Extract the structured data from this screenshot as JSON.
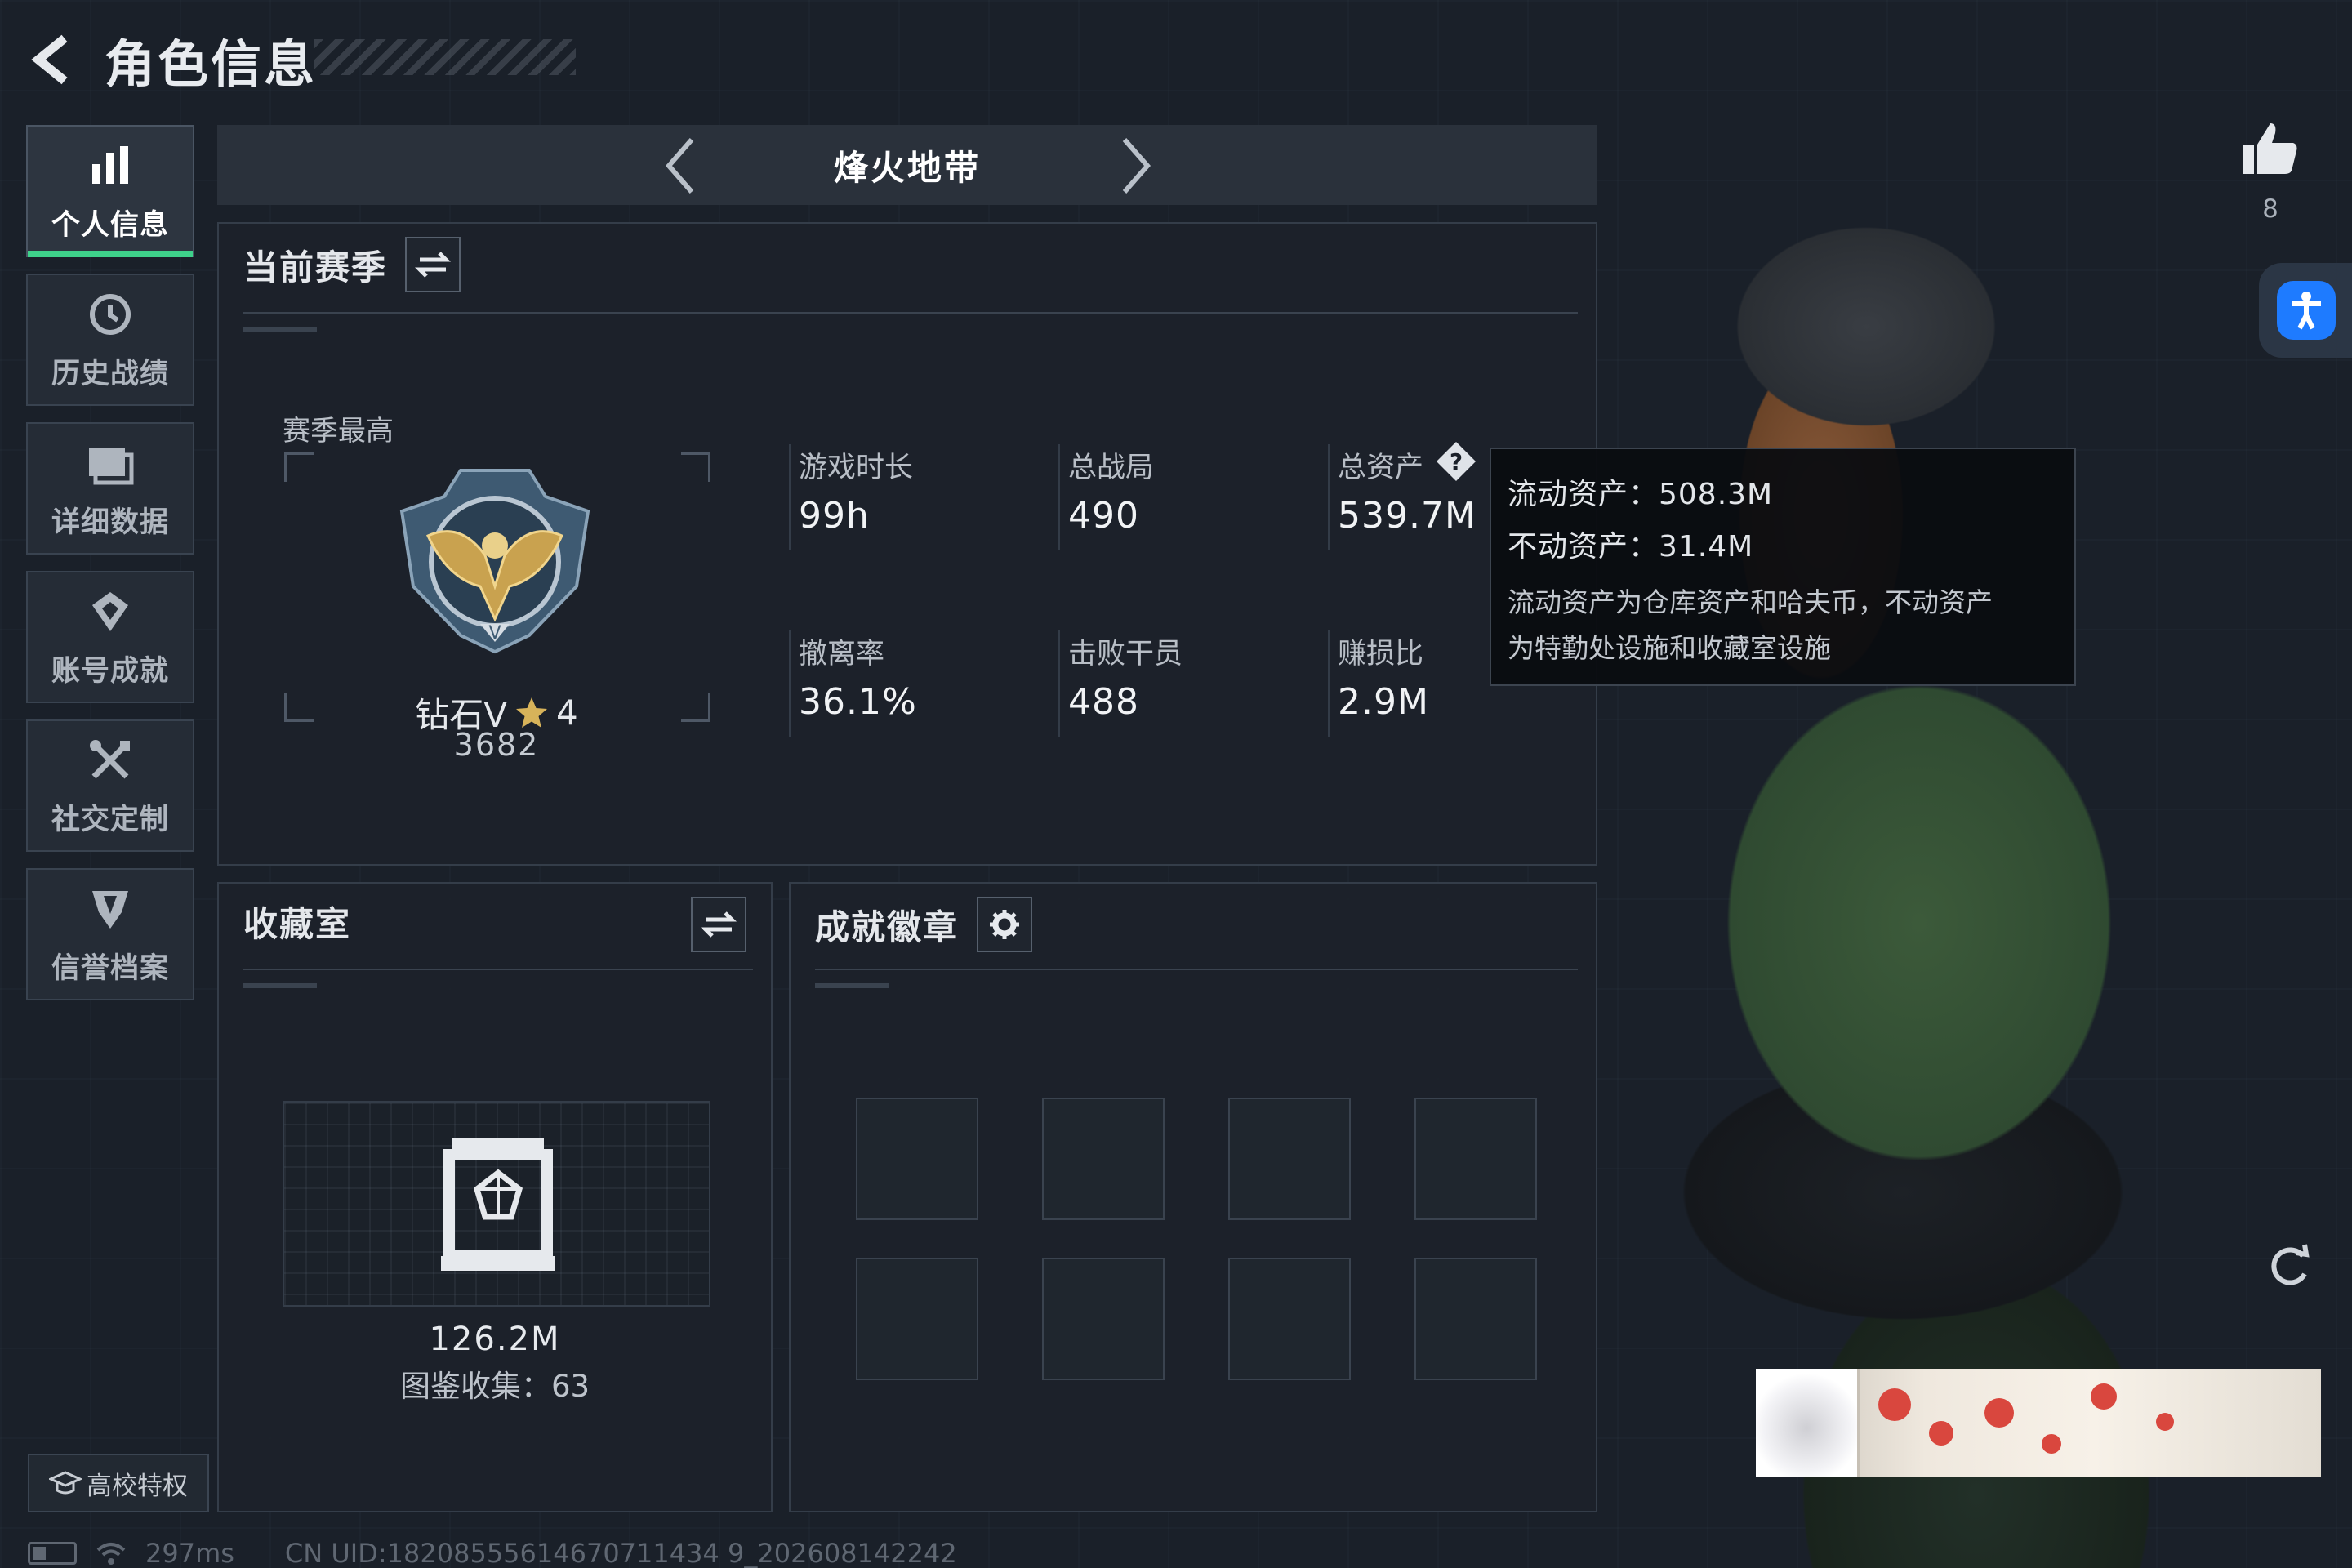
{
  "header": {
    "title": "角色信息"
  },
  "sidebar": {
    "items": [
      {
        "label": "个人信息",
        "icon": "bar-chart-icon",
        "active": true
      },
      {
        "label": "历史战绩",
        "icon": "history-clock-icon",
        "active": false
      },
      {
        "label": "详细数据",
        "icon": "folder-icon",
        "active": false
      },
      {
        "label": "账号成就",
        "icon": "achievement-icon",
        "active": false
      },
      {
        "label": "社交定制",
        "icon": "tools-icon",
        "active": false
      },
      {
        "label": "信誉档案",
        "icon": "credit-shield-icon",
        "active": false
      }
    ],
    "school_label": "高校特权"
  },
  "mode_bar": {
    "title": "烽火地带"
  },
  "season": {
    "title": "当前赛季",
    "best_label": "赛季最高",
    "rank_name": "钻石V",
    "rank_stars": "4",
    "rank_score": "3682",
    "stats": [
      {
        "label": "游戏时长",
        "value": "99h"
      },
      {
        "label": "总战局",
        "value": "490"
      },
      {
        "label": "总资产",
        "value": "539.7M"
      },
      {
        "label": "撤离率",
        "value": "36.1%"
      },
      {
        "label": "击败干员",
        "value": "488"
      },
      {
        "label": "赚损比",
        "value": "2.9M"
      }
    ]
  },
  "tooltip": {
    "liquid": "流动资产：508.3M",
    "fixed": "不动资产：31.4M",
    "desc_line1": "流动资产为仓库资产和哈夫币，不动资产",
    "desc_line2": "为特勤处设施和收藏室设施"
  },
  "collection": {
    "title": "收藏室",
    "value": "126.2M",
    "count_label": "图鉴收集：63"
  },
  "achievements": {
    "title": "成就徽章"
  },
  "social": {
    "like_count": "8"
  },
  "status_bar": {
    "ping": "297ms",
    "uid": "CN UID:18208555614670711434 9_202608142242"
  },
  "colors": {
    "accent_green": "#3ed18a",
    "background": "#1a2029",
    "access_blue": "#1e7bff",
    "rank_star": "#d7b35a"
  }
}
